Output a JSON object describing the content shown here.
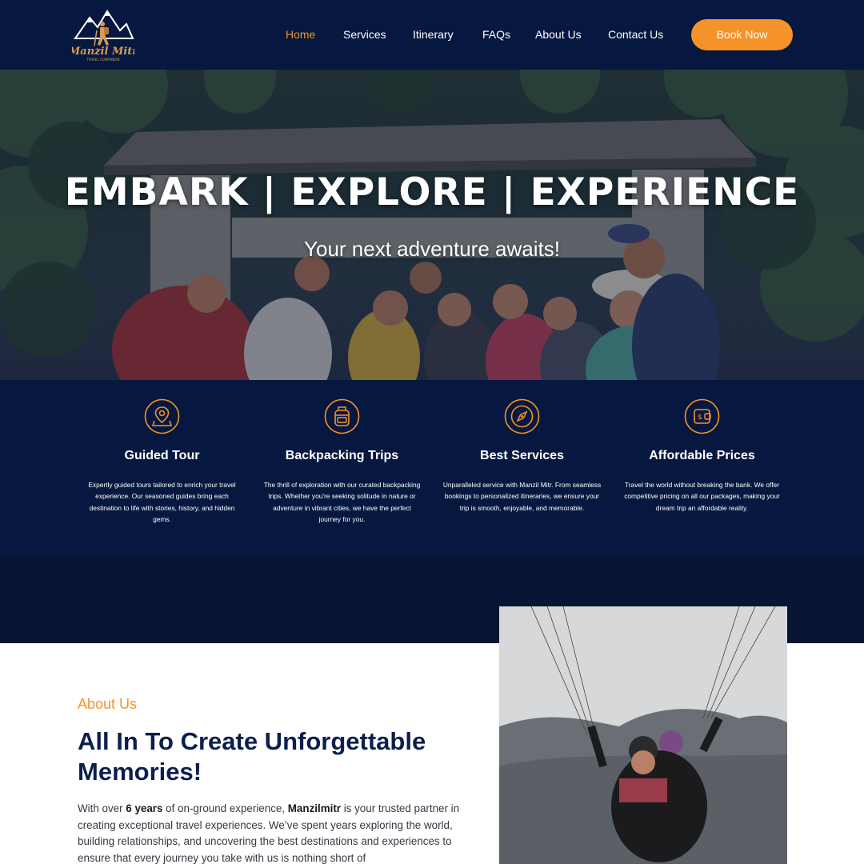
{
  "brand": {
    "logo_name": "Manzil Mitr",
    "logo_tagline": "TRAVEL COMPANION"
  },
  "nav": {
    "items": [
      {
        "label": "Home",
        "active": true
      },
      {
        "label": "Services",
        "active": false
      },
      {
        "label": "Itinerary",
        "active": false
      },
      {
        "label": "FAQs",
        "active": false
      },
      {
        "label": "About Us",
        "active": false
      },
      {
        "label": "Contact Us",
        "active": false
      }
    ],
    "cta_label": "Book Now"
  },
  "hero": {
    "title": "EMBARK | EXPLORE | EXPERIENCE",
    "subtitle": "Your next adventure awaits!"
  },
  "features": [
    {
      "icon": "map-pin-icon",
      "title": "Guided Tour",
      "description": "Expertly guided tours tailored to enrich your travel experience. Our seasoned guides bring each destination to life with stories, history, and hidden gems."
    },
    {
      "icon": "backpack-icon",
      "title": "Backpacking Trips",
      "description": "The thrill of exploration with our curated backpacking trips. Whether you're seeking solitude in nature or adventure in vibrant cities, we have the perfect journey for you."
    },
    {
      "icon": "compass-icon",
      "title": "Best Services",
      "description": "Unparalleled service with Manzil Mitr. From seamless bookings to personalized itineraries, we ensure your trip is smooth, enjoyable, and memorable."
    },
    {
      "icon": "wallet-icon",
      "title": "Affordable Prices",
      "description": "Travel the world without breaking the bank. We offer competitive pricing on all our packages, making your dream trip an affordable reality."
    }
  ],
  "about": {
    "label": "About Us",
    "heading": "All In To Create Unforgettable Memories!",
    "text_1": "With over ",
    "text_bold_1": "6 years",
    "text_2": " of on-ground experience, ",
    "text_bold_2": "Manzilmitr",
    "text_3": " is your trusted partner in creating exceptional travel experiences. We’ve spent years exploring the world, building relationships, and uncovering the best destinations and experiences to ensure that every journey you take with us is nothing short of"
  },
  "colors": {
    "navy": "#06183f",
    "accent": "#f6922a",
    "heading": "#0b1f4d"
  }
}
